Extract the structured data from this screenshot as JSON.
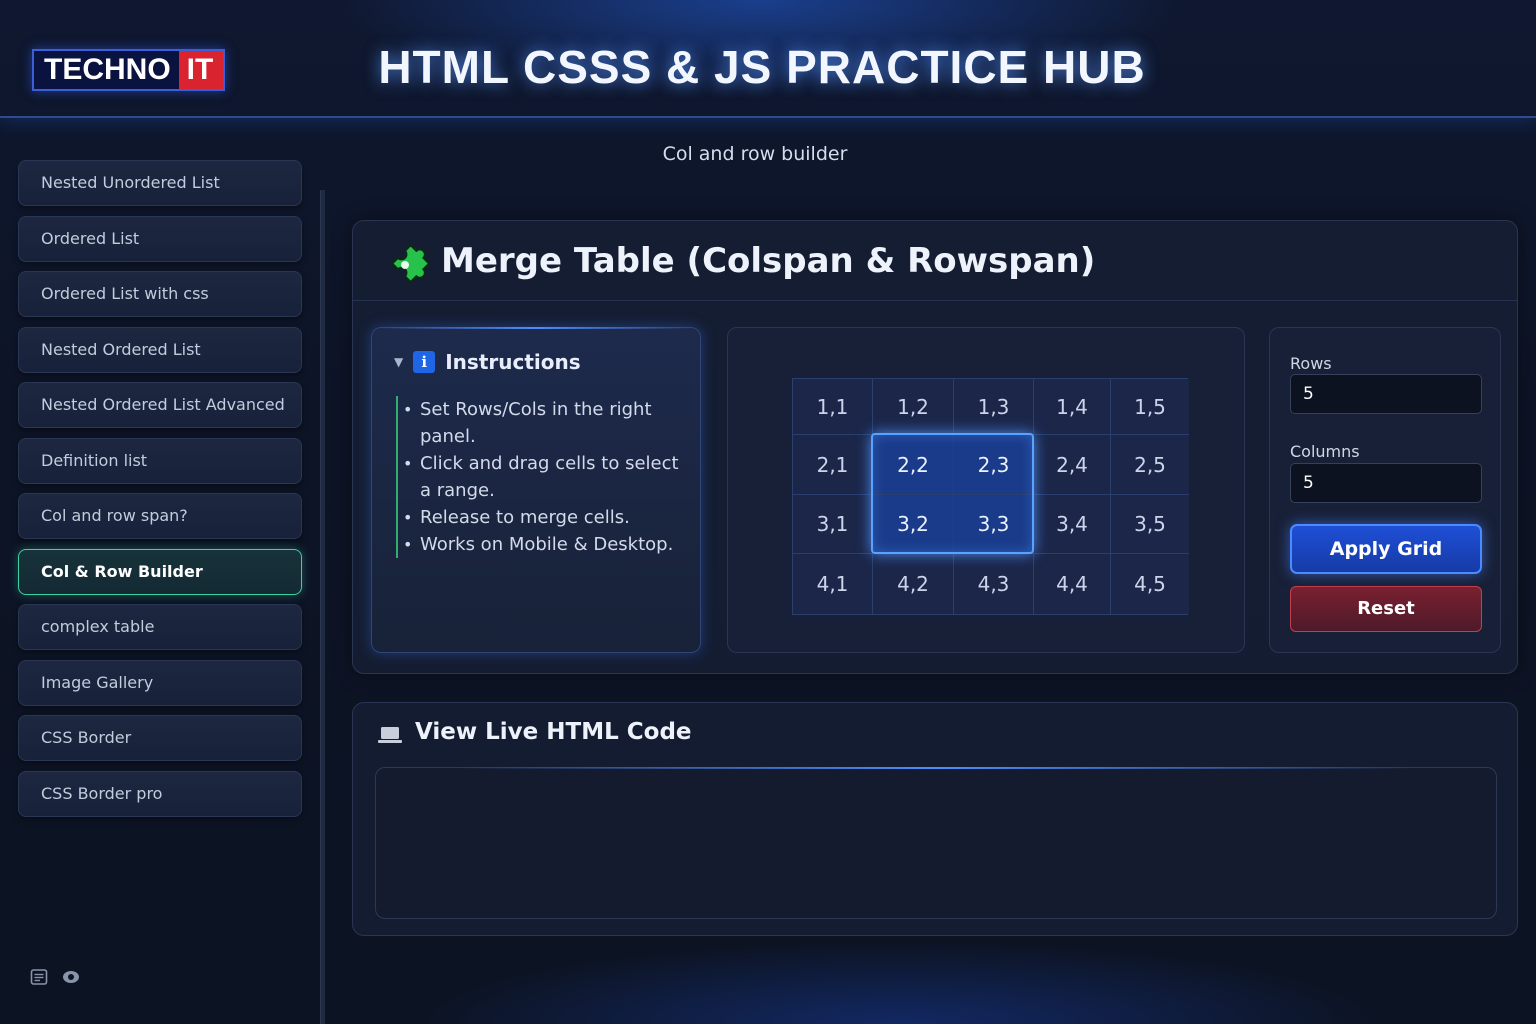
{
  "header": {
    "logo_part1": "TECHNO",
    "logo_part2": "IT",
    "app_title": "HTML CSSS & JS PRACTICE HUB",
    "page_subtitle": "Col and row builder"
  },
  "sidebar": {
    "items": [
      {
        "label": "Nested Unordered List",
        "active": false
      },
      {
        "label": "Ordered List",
        "active": false
      },
      {
        "label": "Ordered List with css",
        "active": false
      },
      {
        "label": "Nested Ordered List",
        "active": false
      },
      {
        "label": "Nested Ordered List Advanced",
        "active": false
      },
      {
        "label": "Definition list",
        "active": false
      },
      {
        "label": "Col and row span?",
        "active": false
      },
      {
        "label": "Col & Row Builder",
        "active": true
      },
      {
        "label": "complex table",
        "active": false
      },
      {
        "label": "Image Gallery",
        "active": false
      },
      {
        "label": "CSS Border",
        "active": false
      },
      {
        "label": "CSS Border pro",
        "active": false
      }
    ],
    "footer_icons": [
      "document-icon",
      "eye-icon"
    ]
  },
  "merge_panel": {
    "icon": "puzzle-icon",
    "title": "Merge Table (Colspan & Rowspan)",
    "instructions": {
      "title": "Instructions",
      "items": [
        "Set Rows/Cols in the right panel.",
        "Click and drag cells to select a range.",
        "Release to merge cells.",
        "Works on Mobile & Desktop."
      ]
    },
    "grid": {
      "rows": [
        [
          "1,1",
          "1,2",
          "1,3",
          "1,4",
          "1,5"
        ],
        [
          "2,1",
          "2,2",
          "2,3",
          "2,4",
          "2,5"
        ],
        [
          "3,1",
          "3,2",
          "3,3",
          "3,4",
          "3,5"
        ],
        [
          "4,1",
          "4,2",
          "4,3",
          "4,4",
          "4,5"
        ]
      ],
      "selected": [
        "2,2",
        "2,3",
        "3,2",
        "3,3"
      ]
    },
    "controls": {
      "rows_label": "Rows",
      "rows_value": "5",
      "columns_label": "Columns",
      "columns_value": "5",
      "apply_label": "Apply Grid",
      "reset_label": "Reset"
    }
  },
  "code_panel": {
    "icon": "laptop-icon",
    "title": "View Live HTML Code",
    "code": ""
  },
  "colors": {
    "accent_blue": "#4a8cff",
    "active_nav_border": "#3fd0a4",
    "reset_red": "#c04050",
    "logo_red": "#d9232f"
  }
}
